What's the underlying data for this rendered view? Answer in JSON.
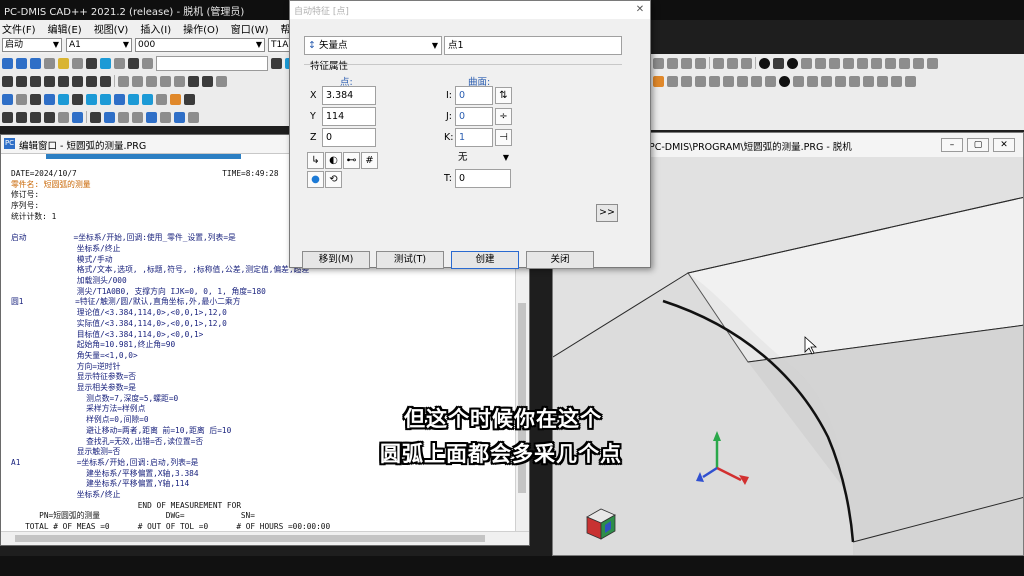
{
  "window": {
    "title": "PC-DMIS CAD++ 2021.2 (release) - 脱机 (管理员)"
  },
  "menu": [
    "文件(F)",
    "编辑(E)",
    "视图(V)",
    "插入(I)",
    "操作(O)",
    "窗口(W)",
    "帮助(H)"
  ],
  "combos": {
    "mode": "启动",
    "alignment": "A1",
    "view": "000",
    "probe_tip": "T1A0"
  },
  "editor": {
    "title": "编辑窗口 - 短圆弧的测量.PRG",
    "lines": [
      {
        "t": "DATE=2024/10/7                               TIME=8:49:28",
        "c": "blk"
      },
      {
        "t": "零件名: 短圆弧的测量",
        "c": "orange"
      },
      {
        "t": "修订号:",
        "c": "blk"
      },
      {
        "t": "序列号:",
        "c": "blk"
      },
      {
        "t": "统计计数: 1",
        "c": "blk"
      },
      {
        "t": "",
        "c": "blk"
      },
      {
        "t": "启动          =坐标系/开始,回调:使用_零件_设置,列表=是",
        "c": "navy"
      },
      {
        "t": "              坐标系/终止",
        "c": "navy"
      },
      {
        "t": "              模式/手动",
        "c": "navy"
      },
      {
        "t": "              格式/文本,选项, ,标题,符号, ;标称值,公差,测定值,偏差,超差",
        "c": "navy"
      },
      {
        "t": "              加载测头/000",
        "c": "navy"
      },
      {
        "t": "              测尖/T1A0B0, 支撑方向 IJK=0, 0, 1, 角度=180",
        "c": "navy"
      },
      {
        "t": "圆1           =特征/触测/圆/默认,直角坐标,外,最小二乘方",
        "c": "navy"
      },
      {
        "t": "              理论值/<3.384,114,0>,<0,0,1>,12,0",
        "c": "navy"
      },
      {
        "t": "              实际值/<3.384,114,0>,<0,0,1>,12,0",
        "c": "navy"
      },
      {
        "t": "              目标值/<3.384,114,0>,<0,0,1>",
        "c": "navy"
      },
      {
        "t": "              起始角=10.981,终止角=90",
        "c": "navy"
      },
      {
        "t": "              角矢量=<1,0,0>",
        "c": "navy"
      },
      {
        "t": "              方向=逆时针",
        "c": "navy"
      },
      {
        "t": "              显示特征参数=否",
        "c": "navy"
      },
      {
        "t": "              显示相关参数=是",
        "c": "navy"
      },
      {
        "t": "                测点数=7,深度=5,螺距=0",
        "c": "navy"
      },
      {
        "t": "                采样方法=样例点",
        "c": "navy"
      },
      {
        "t": "                样例点=0,间隙=0",
        "c": "navy"
      },
      {
        "t": "                避让移动=两者,距离 前=10,距离 后=10",
        "c": "navy"
      },
      {
        "t": "                查找孔=无效,出错=否,读位置=否",
        "c": "navy"
      },
      {
        "t": "              显示触测=否",
        "c": "navy"
      },
      {
        "t": "A1            =坐标系/开始,回调:启动,列表=是",
        "c": "navy"
      },
      {
        "t": "                建坐标系/平移偏置,X轴,3.384",
        "c": "navy"
      },
      {
        "t": "                建坐标系/平移偏置,Y轴,114",
        "c": "navy"
      },
      {
        "t": "              坐标系/终止",
        "c": "navy"
      },
      {
        "t": "                           END OF MEASUREMENT FOR",
        "c": "blk"
      },
      {
        "t": "      PN=短圆弧的测量              DWG=            SN=",
        "c": "blk"
      },
      {
        "t": "   TOTAL # OF MEAS =0      # OUT OF TOL =0      # OF HOURS =00:00:00",
        "c": "blk"
      }
    ]
  },
  "cad": {
    "title": "PC-DMIS\\PROGRAM\\短圆弧的测量.PRG - 脱机"
  },
  "dialog": {
    "title": "自动特征 [点]",
    "type": "矢量点",
    "id": "点1",
    "group": "特征属性",
    "point_label": "点:",
    "surface_label": "曲面:",
    "x": "3.384",
    "y": "114",
    "z": "0",
    "i": "0",
    "j": "0",
    "k": "1",
    "thickness_option": "无",
    "t": "0",
    "labels": {
      "x": "X",
      "y": "Y",
      "z": "Z",
      "i": "I:",
      "j": "J:",
      "k": "K:",
      "t": "T:"
    },
    "expand": ">>",
    "buttons": {
      "move": "移到(M)",
      "test": "测试(T)",
      "create": "创建",
      "close": "关闭"
    }
  },
  "subtitle": {
    "line1": "但这个时候你在这个",
    "line2": "圆弧上面都会多采几个点"
  }
}
